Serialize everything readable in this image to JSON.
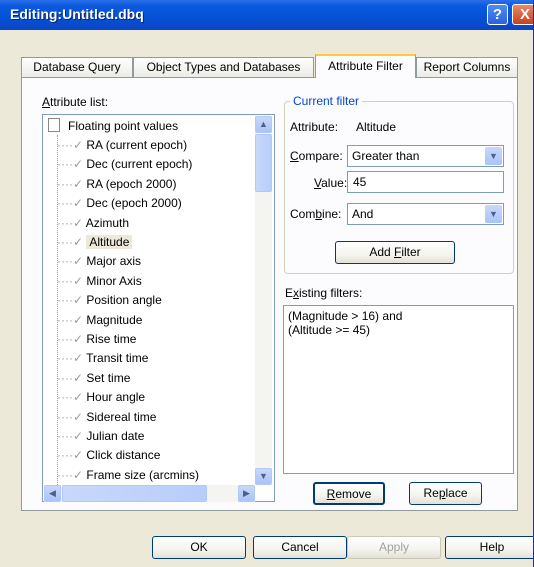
{
  "window": {
    "title": "Editing:Untitled.dbq",
    "help_glyph": "?",
    "close_glyph": "X"
  },
  "tabs": [
    {
      "label": "Database Query"
    },
    {
      "label": "Object Types and Databases"
    },
    {
      "label": "Attribute Filter"
    },
    {
      "label": "Report Columns"
    }
  ],
  "attribute_list": {
    "label_acc": "A",
    "label_rest": "ttribute list:",
    "root": "Floating point values",
    "items": [
      "RA (current epoch)",
      "Dec (current epoch)",
      "RA (epoch 2000)",
      "Dec (epoch 2000)",
      "Azimuth",
      "Altitude",
      "Major axis",
      "Minor Axis",
      "Position angle",
      "Magnitude",
      "Rise time",
      "Transit time",
      "Set time",
      "Hour angle",
      "Sidereal time",
      "Julian date",
      "Click distance",
      "Frame size (arcmins)"
    ],
    "selected": "Altitude"
  },
  "current_filter": {
    "legend": "Current filter",
    "attribute_label": "Attribute:",
    "attribute_value": "Altitude",
    "compare_acc": "C",
    "compare_rest": "ompare:",
    "compare_value": "Greater than",
    "value_acc": "V",
    "value_rest": "alue:",
    "value_text": "45",
    "combine_pre": "Com",
    "combine_acc": "b",
    "combine_post": "ine:",
    "combine_value": "And",
    "add_pre": "Add ",
    "add_acc": "F",
    "add_post": "ilter"
  },
  "existing": {
    "label_pre": "E",
    "label_acc": "x",
    "label_post": "isting filters:",
    "line1": "(Magnitude > 16) and",
    "line2": "(Altitude >= 45)"
  },
  "filter_buttons": {
    "remove_acc": "R",
    "remove_rest": "emove",
    "replace_pre": "Re",
    "replace_acc": "p",
    "replace_post": "lace"
  },
  "dialog_buttons": {
    "ok": "OK",
    "cancel": "Cancel",
    "apply": "Apply",
    "help": "Help"
  }
}
